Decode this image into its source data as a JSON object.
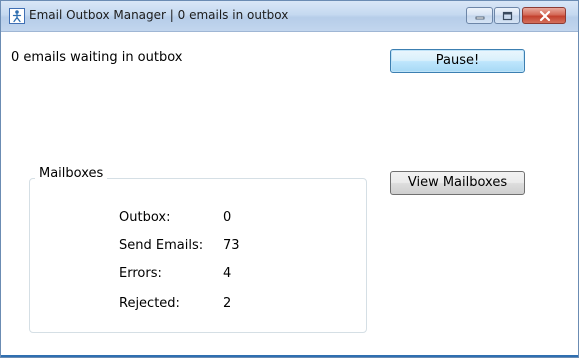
{
  "window": {
    "title": "Email Outbox Manager | 0 emails in outbox",
    "icon": "app-person-icon",
    "controls": {
      "minimize_icon": "minimize-icon",
      "maximize_icon": "maximize-icon",
      "close_icon": "close-icon"
    }
  },
  "status": {
    "text": "0 emails waiting in outbox"
  },
  "buttons": {
    "pause_label": "Pause!",
    "view_mailboxes_label": "View Mailboxes"
  },
  "mailboxes": {
    "legend": "Mailboxes",
    "rows": [
      {
        "label": "Outbox:",
        "value": "0"
      },
      {
        "label": "Send Emails:",
        "value": "73"
      },
      {
        "label": "Errors:",
        "value": "4"
      },
      {
        "label": "Rejected:",
        "value": "2"
      }
    ]
  },
  "colors": {
    "title_bar": "#c5d9f0",
    "accent": "#2f6fb0",
    "close_button": "#c3412e",
    "pause_button_focus": "#3c7fb1"
  }
}
